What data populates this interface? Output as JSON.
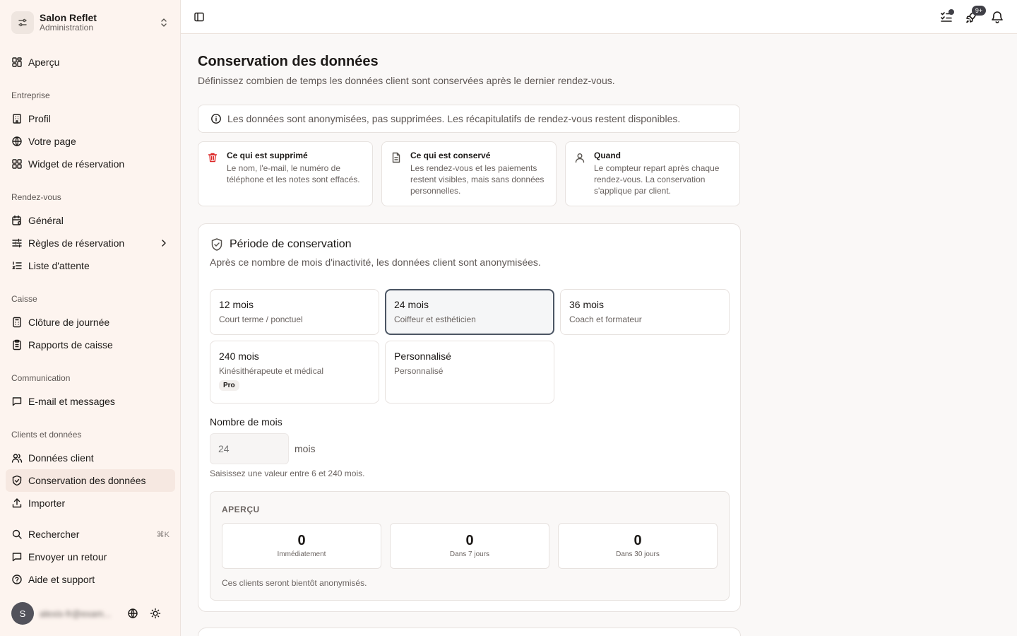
{
  "org": {
    "name": "Salon Reflet",
    "role": "Administration"
  },
  "nav": {
    "overview": "Aperçu",
    "sections": {
      "company": "Entreprise",
      "appointments": "Rendez-vous",
      "register": "Caisse",
      "communication": "Communication",
      "clients": "Clients et données"
    },
    "profile": "Profil",
    "your_page": "Votre page",
    "booking_widget": "Widget de réservation",
    "general": "Général",
    "booking_rules": "Règles de réservation",
    "waitlist": "Liste d'attente",
    "day_close": "Clôture de journée",
    "cash_reports": "Rapports de caisse",
    "email_messages": "E-mail et messages",
    "client_data": "Données client",
    "data_retention": "Conservation des données",
    "import": "Importer",
    "search": "Rechercher",
    "search_shortcut": "⌘K",
    "feedback": "Envoyer un retour",
    "help": "Aide et support"
  },
  "user": {
    "initial": "S",
    "name": "alexis-fr@exam..."
  },
  "topbar": {
    "notif_count": "9+"
  },
  "page": {
    "title": "Conservation des données",
    "subtitle": "Définissez combien de temps les données client sont conservées après le dernier rendez-vous.",
    "notice": "Les données sont anonymisées, pas supprimées. Les récapitulatifs de rendez-vous restent disponibles.",
    "cards": [
      {
        "title": "Ce qui est supprimé",
        "desc": "Le nom, l'e-mail, le numéro de téléphone et les notes sont effacés."
      },
      {
        "title": "Ce qui est conservé",
        "desc": "Les rendez-vous et les paiements restent visibles, mais sans données personnelles."
      },
      {
        "title": "Quand",
        "desc": "Le compteur repart après chaque rendez-vous. La conservation s'applique par client."
      }
    ]
  },
  "retention": {
    "title": "Période de conservation",
    "subtitle": "Après ce nombre de mois d'inactivité, les données client sont anonymisées.",
    "options": [
      {
        "label": "12 mois",
        "desc": "Court terme / ponctuel"
      },
      {
        "label": "24 mois",
        "desc": "Coiffeur et esthéticien",
        "selected": true
      },
      {
        "label": "36 mois",
        "desc": "Coach et formateur"
      },
      {
        "label": "240 mois",
        "desc": "Kinésithérapeute et médical",
        "badge": "Pro"
      },
      {
        "label": "Personnalisé",
        "desc": "Personnalisé"
      }
    ],
    "months_label": "Nombre de mois",
    "months_placeholder": "24",
    "months_unit": "mois",
    "months_hint": "Saisissez une valeur entre 6 et 240 mois.",
    "preview": {
      "label": "APERÇU",
      "stats": [
        {
          "value": "0",
          "label": "Immédiatement"
        },
        {
          "value": "0",
          "label": "Dans 7 jours"
        },
        {
          "value": "0",
          "label": "Dans 30 jours"
        }
      ],
      "note": "Ces clients seront bientôt anonymisés."
    }
  }
}
